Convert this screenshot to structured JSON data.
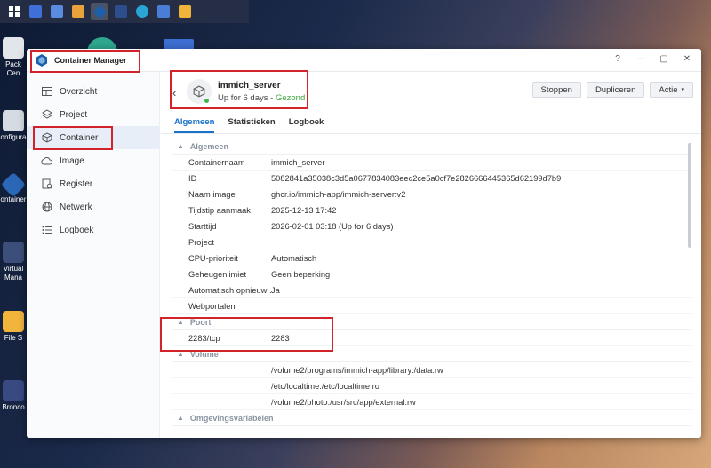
{
  "desktop": {
    "taskbar": {
      "icons": [
        {
          "name": "grid-menu-icon",
          "color": "#ffffff"
        },
        {
          "name": "dashboard-icon",
          "color": "#3f6fd8"
        },
        {
          "name": "control-panel-icon",
          "color": "#5a8be0"
        },
        {
          "name": "package-center-icon",
          "color": "#e9a23b"
        },
        {
          "name": "container-manager-icon",
          "color": "#1d5fa8"
        },
        {
          "name": "virtual-machine-icon",
          "color": "#2d4e8c"
        },
        {
          "name": "synology-drive-icon",
          "color": "#2aa6d6"
        },
        {
          "name": "storage-icon",
          "color": "#4a7ed6"
        },
        {
          "name": "file-station-icon",
          "color": "#f0b43a"
        }
      ]
    },
    "icons": [
      {
        "label": "Pack Cen",
        "color": "#e2e5ea"
      },
      {
        "label": "onfigura",
        "color": "#d6dbe3"
      },
      {
        "label": "ontainer",
        "color": "#2a67b6"
      },
      {
        "label": "Virtual Mana",
        "color": "#3b4f7a"
      },
      {
        "label": "File S",
        "color": "#f1b53c"
      },
      {
        "label": "Bronco",
        "color": "#394a82"
      }
    ]
  },
  "window": {
    "title": "Container Manager",
    "controls": {
      "help": "?",
      "minimize": "—",
      "maximize": "▢",
      "close": "✕"
    },
    "accent": "#1a72c9",
    "highlight_color": "#d2232a"
  },
  "sidebar": {
    "items": [
      {
        "label": "Overzicht",
        "icon": "overview-icon"
      },
      {
        "label": "Project",
        "icon": "project-icon"
      },
      {
        "label": "Container",
        "icon": "container-icon",
        "selected": true
      },
      {
        "label": "Image",
        "icon": "image-icon"
      },
      {
        "label": "Register",
        "icon": "registry-icon"
      },
      {
        "label": "Netwerk",
        "icon": "network-icon"
      },
      {
        "label": "Logboek",
        "icon": "log-icon"
      }
    ]
  },
  "container": {
    "name": "immich_server",
    "uptime": "Up for 6 days",
    "separator": " - ",
    "health": "Gezond"
  },
  "actions": {
    "stop": "Stoppen",
    "duplicate": "Dupliceren",
    "action": "Actie"
  },
  "tabs": [
    {
      "label": "Algemeen",
      "active": true
    },
    {
      "label": "Statistieken"
    },
    {
      "label": "Logboek"
    }
  ],
  "sections": {
    "general": {
      "title": "Algemeen",
      "rows": [
        {
          "key": "Containernaam",
          "value": "immich_server"
        },
        {
          "key": "ID",
          "value": "5082841a35038c3d5a0677834083eec2ce5a0cf7e2826666445365d62199d7b9"
        },
        {
          "key": "Naam image",
          "value": "ghcr.io/immich-app/immich-server:v2"
        },
        {
          "key": "Tijdstip aanmaak",
          "value": "2025-12-13 17:42"
        },
        {
          "key": "Starttijd",
          "value": "2026-02-01 03:18 (Up for 6 days)"
        },
        {
          "key": "Project",
          "value": ""
        },
        {
          "key": "CPU-prioriteit",
          "value": "Automatisch"
        },
        {
          "key": "Geheugenlimiet",
          "value": "Geen beperking"
        },
        {
          "key": "Automatisch opnieuw ...",
          "value": "Ja"
        },
        {
          "key": "Webportalen",
          "value": ""
        }
      ]
    },
    "port": {
      "title": "Poort",
      "rows": [
        {
          "key": "2283/tcp",
          "value": "2283"
        }
      ]
    },
    "volume": {
      "title": "Volume",
      "rows": [
        {
          "key": "",
          "value": "/volume2/programs/immich-app/library:/data:rw"
        },
        {
          "key": "",
          "value": "/etc/localtime:/etc/localtime:ro"
        },
        {
          "key": "",
          "value": "/volume2/photo:/usr/src/app/external:rw"
        }
      ]
    },
    "env": {
      "title": "Omgevingsvariabelen"
    }
  }
}
